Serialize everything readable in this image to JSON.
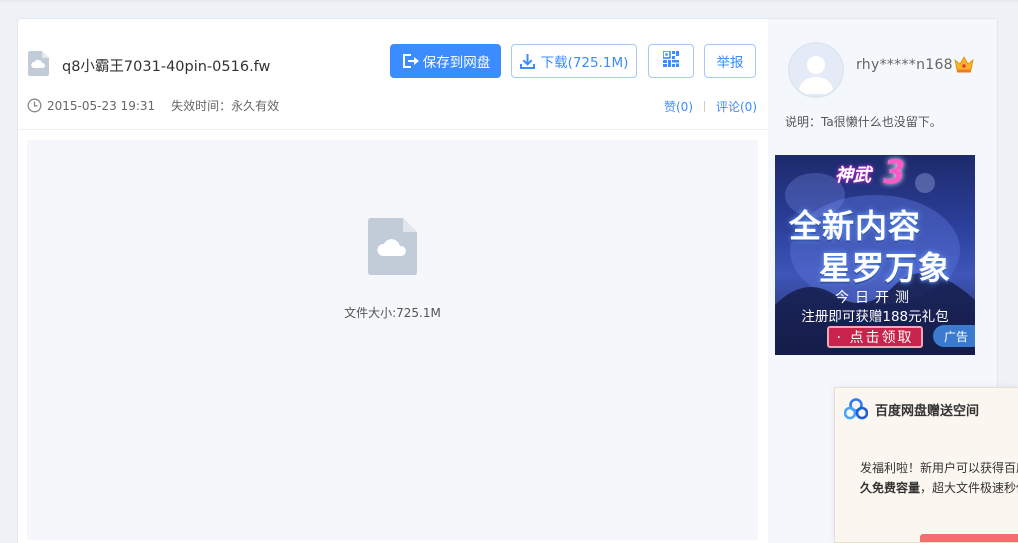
{
  "file": {
    "name": "q8小霸王7031-40pin-0516.fw",
    "date": "2015-05-23 19:31",
    "expire": "失效时间：永久有效",
    "size_text": "文件大小:725.1M"
  },
  "toolbar": {
    "save_label": "保存到网盘",
    "download_label": "下载(725.1M)",
    "report_label": "举报"
  },
  "actions": {
    "like_label": "赞(0)",
    "comment_label": "评论(0)"
  },
  "sidebar": {
    "username": "rhy*****n168",
    "description": "说明：Ta很懒什么也没留下。"
  },
  "ad": {
    "logo_text": "神武",
    "logo_num": "3",
    "line1": "全新内容",
    "line2": "星罗万象",
    "line3": "今日开测",
    "line4": "注册即可获赠188元礼包",
    "cta": "· 点击领取",
    "tag": "广告"
  },
  "promo": {
    "title": "百度网盘赠送空间",
    "text_line1": "发福利啦！新用户可以获得百度网盘永",
    "text_line2_bold": "久免费容量",
    "text_line2_rest": "，超大文件极速秒传"
  },
  "colors": {
    "accent": "#3b8cff",
    "preview_bg": "#f5f7fa",
    "icon_gray": "#c2ccd8"
  }
}
